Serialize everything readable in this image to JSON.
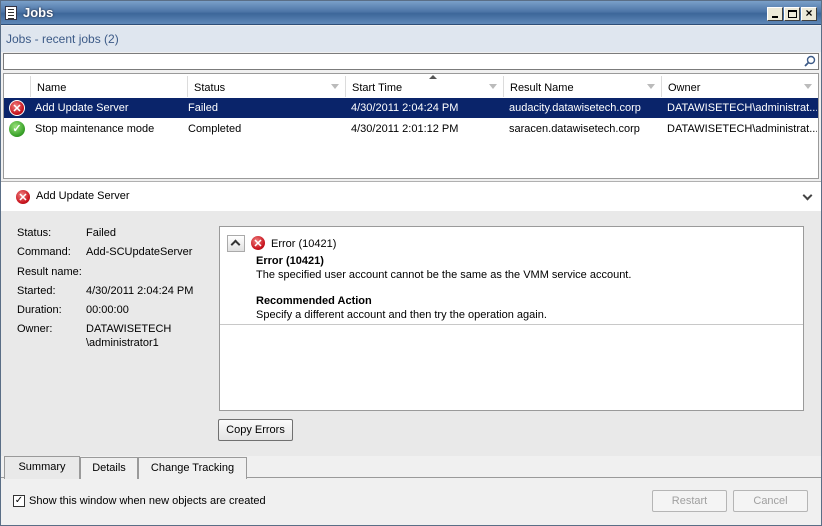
{
  "window": {
    "title": "Jobs",
    "subtitle": "Jobs - recent jobs (2)"
  },
  "search": {
    "value": "",
    "placeholder": ""
  },
  "grid": {
    "columns": [
      "Name",
      "Status",
      "Start Time",
      "Result Name",
      "Owner"
    ],
    "sorted_column": "Start Time",
    "rows": [
      {
        "status_icon": "error-icon",
        "name": "Add Update Server",
        "status": "Failed",
        "start_time": "4/30/2011 2:04:24 PM",
        "result_name": "audacity.datawisetech.corp",
        "owner": "DATAWISETECH\\administrat...",
        "selected": true
      },
      {
        "status_icon": "success-icon",
        "name": "Stop maintenance mode",
        "status": "Completed",
        "start_time": "4/30/2011 2:01:12 PM",
        "result_name": "saracen.datawisetech.corp",
        "owner": "DATAWISETECH\\administrat...",
        "selected": false
      }
    ]
  },
  "details": {
    "title": "Add Update Server",
    "status_label": "Status:",
    "status_value": "Failed",
    "command_label": "Command:",
    "command_value": "Add-SCUpdateServer",
    "result_label": "Result name:",
    "result_value": "",
    "started_label": "Started:",
    "started_value": "4/30/2011 2:04:24 PM",
    "duration_label": "Duration:",
    "duration_value": "00:00:00",
    "owner_label": "Owner:",
    "owner_value_1": "DATAWISETECH",
    "owner_value_2": "\\administrator1",
    "error": {
      "label": "Error (10421)",
      "title": "Error (10421)",
      "message": "The specified user account cannot be the same as the VMM service account.",
      "rec_title": "Recommended Action",
      "rec_message": "Specify a different account and then try the operation again."
    },
    "copy_errors": "Copy Errors"
  },
  "tabs": [
    "Summary",
    "Details",
    "Change Tracking"
  ],
  "active_tab": "Summary",
  "footer": {
    "checkbox_label": "Show this window when new objects are created",
    "checkbox_checked": true,
    "restart": "Restart",
    "cancel": "Cancel"
  },
  "colors": {
    "selection": "#0a246a",
    "error": "#c8141e",
    "success": "#3aa22a",
    "header_text": "#3c5a87"
  }
}
